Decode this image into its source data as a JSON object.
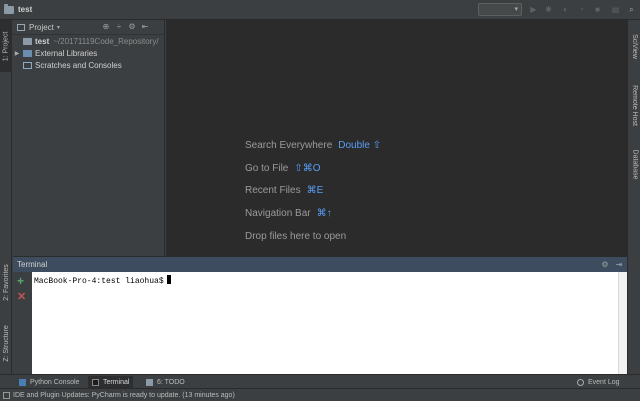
{
  "window": {
    "title": "test"
  },
  "toolbar": {
    "icons": [
      "run-icon",
      "debug-icon",
      "coverage-icon",
      "profile-icon",
      "stop-icon",
      "search-icon"
    ]
  },
  "left_stripe": {
    "tabs": [
      {
        "label": "1: Project"
      },
      {
        "label": "2: Favorites"
      },
      {
        "label": "Z: Structure"
      }
    ]
  },
  "right_stripe": {
    "tabs": [
      {
        "label": "SciView"
      },
      {
        "label": "Remote Host"
      },
      {
        "label": "Database"
      }
    ]
  },
  "project": {
    "header_label": "Project",
    "tree": [
      {
        "name": "test",
        "path": "~/20171119Code_Repository/",
        "bold": true
      },
      {
        "name": "External Libraries"
      },
      {
        "name": "Scratches and Consoles"
      }
    ]
  },
  "editor": {
    "hints": [
      {
        "label": "Search Everywhere",
        "shortcut": "Double ⇧"
      },
      {
        "label": "Go to File",
        "shortcut": "⇧⌘O"
      },
      {
        "label": "Recent Files",
        "shortcut": "⌘E"
      },
      {
        "label": "Navigation Bar",
        "shortcut": "⌘↑"
      },
      {
        "label": "Drop files here to open",
        "shortcut": ""
      }
    ]
  },
  "terminal": {
    "title": "Terminal",
    "prompt": "MacBook-Pro-4:test liaohua$"
  },
  "bottom_tools": {
    "python_console": "Python Console",
    "terminal": "Terminal",
    "todo": "6: TODO",
    "event_log": "Event Log"
  },
  "status": {
    "message": "IDE and Plugin Updates: PyCharm is ready to update. (13 minutes ago)"
  },
  "colors": {
    "background": "#3c3f41",
    "editor": "#2b2b2b",
    "accent": "#589df6",
    "terminal_header": "#3d4c5e"
  }
}
